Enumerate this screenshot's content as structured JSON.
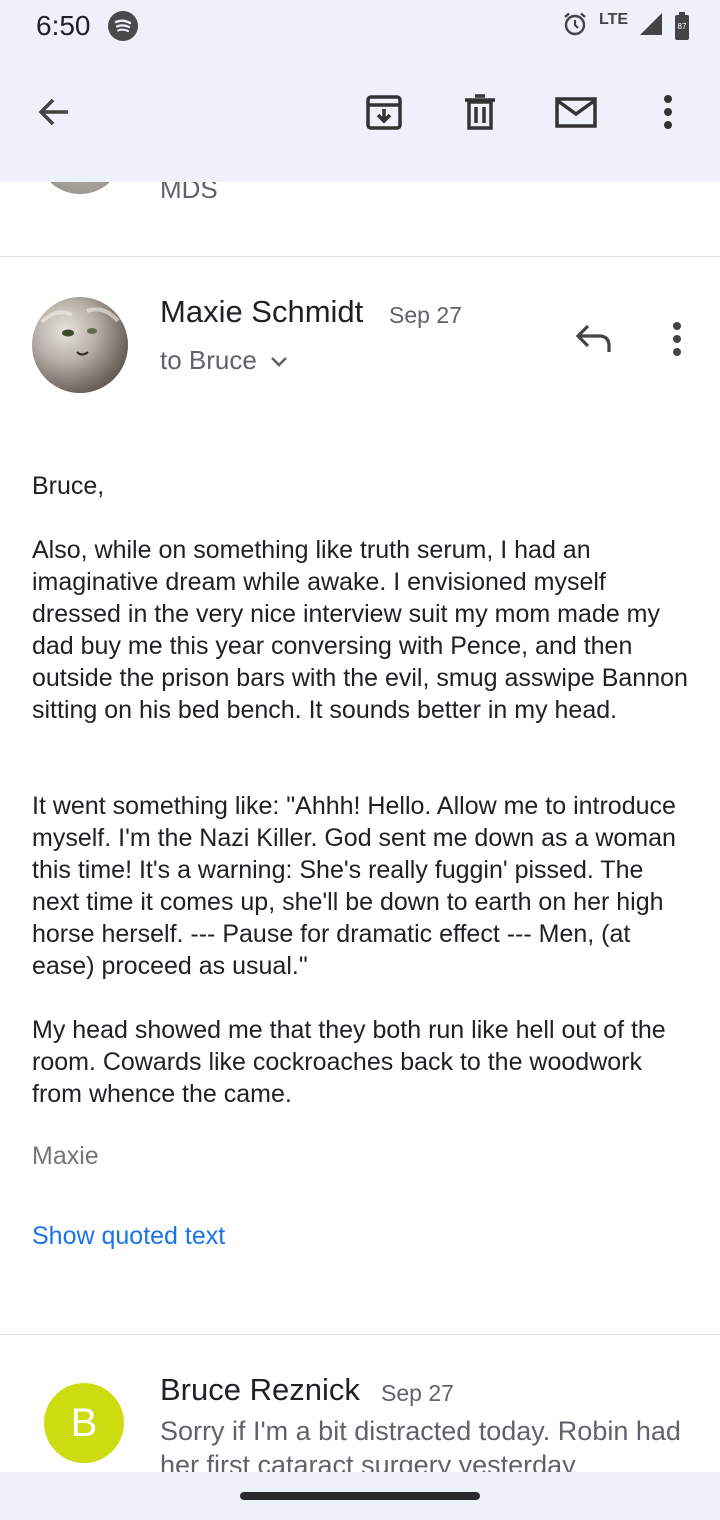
{
  "status_bar": {
    "time": "6:50",
    "network": "LTE",
    "battery_level": "87",
    "icons": [
      "spotify-icon",
      "alarm-icon",
      "signal-icon",
      "battery-icon"
    ]
  },
  "toolbar": {
    "icons": [
      "back-arrow-icon",
      "archive-icon",
      "delete-icon",
      "mark-unread-icon",
      "more-vert-icon"
    ]
  },
  "previous_message": {
    "sender_preview": "MDS"
  },
  "message": {
    "sender": "Maxie Schmidt",
    "date": "Sep 27",
    "recipient": "to Bruce",
    "greeting": "Bruce,",
    "paragraphs": [
      "Also, while on something like truth serum, I had an imaginative dream while awake. I envisioned myself dressed in the very nice interview suit my mom made my dad buy me this year conversing with Pence, and then outside the prison bars with the evil, smug asswipe Bannon sitting on his bed bench. It sounds better in my head.",
      "It went something like: \"Ahhh! Hello. Allow me to introduce myself. I'm the Nazi Killer. God sent me down as a woman this time! It's a warning: She's really fuggin' pissed. The next time it comes up, she'll be down to earth on her high horse herself. --- Pause for dramatic effect --- Men, (at ease) proceed as usual.\"",
      "My head showed me that they both run like hell out of the room. Cowards like cockroaches back to the woodwork from whence the came."
    ],
    "signature": "Maxie",
    "show_quoted_label": "Show quoted text"
  },
  "next_message": {
    "avatar_letter": "B",
    "avatar_color": "#cddc11",
    "sender": "Bruce Reznick",
    "date": "Sep 27",
    "snippet": "Sorry if I'm a bit distracted today. Robin had her first cataract surgery yesterday"
  },
  "colors": {
    "header_bg": "#eef1fa",
    "link": "#1a73e8"
  }
}
